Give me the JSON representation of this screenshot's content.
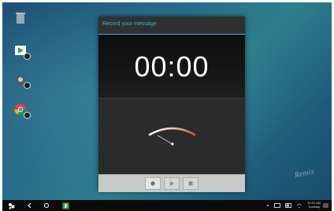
{
  "dialog": {
    "title": "Record your message",
    "timer": "00:00",
    "buttons": {
      "record": "record",
      "play": "play",
      "stop": "stop"
    }
  },
  "taskbar": {
    "clock_time": "10:31 AM",
    "clock_day": "Tuesday"
  },
  "watermark": "Remix",
  "colors": {
    "accent": "#33b5e5",
    "meter_start": "#ffffff",
    "meter_end": "#e0532b"
  },
  "icons": [
    "trash-icon",
    "play-store-icon",
    "settings-icon",
    "chrome-icon",
    "remix-logo-icon",
    "back-icon",
    "home-icon",
    "app-icon",
    "wifi-icon",
    "battery-icon",
    "menu-icon"
  ]
}
